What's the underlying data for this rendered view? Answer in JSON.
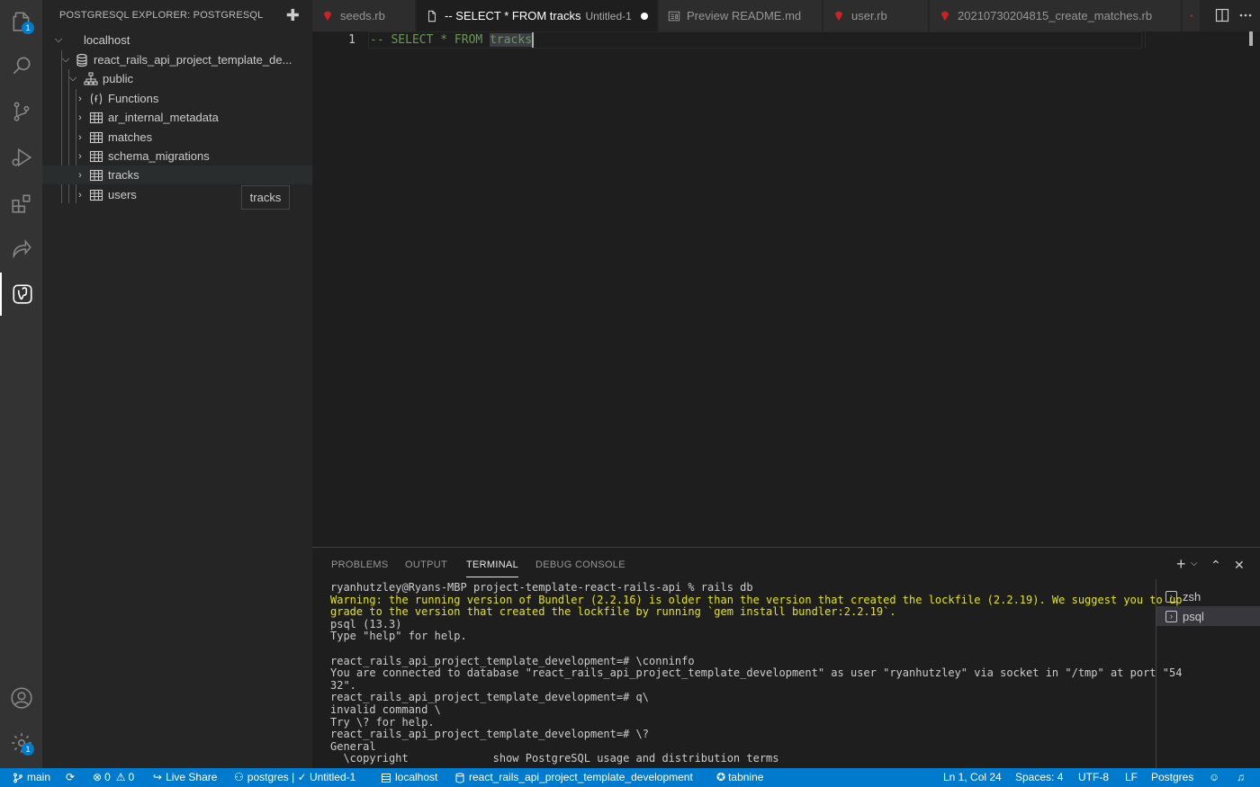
{
  "activity_bar": {
    "explorer_badge": "1",
    "settings_badge": "1"
  },
  "sidebar": {
    "title": "POSTGRESQL EXPLORER: POSTGRESQL",
    "tree": {
      "server": "localhost",
      "database": "react_rails_api_project_template_de...",
      "schema": "public",
      "items": [
        "Functions",
        "ar_internal_metadata",
        "matches",
        "schema_migrations",
        "tracks",
        "users"
      ]
    },
    "tooltip": "tracks"
  },
  "tabs": [
    {
      "label": "seeds.rb"
    },
    {
      "label": "-- SELECT * FROM tracks",
      "sub": "Untitled-1"
    },
    {
      "label": "Preview README.md"
    },
    {
      "label": "user.rb"
    },
    {
      "label": "20210730204815_create_matches.rb"
    }
  ],
  "editor": {
    "line_number": "1",
    "code_prefix": "-- SELECT * FROM ",
    "code_word": "tracks"
  },
  "panel": {
    "tabs": [
      "PROBLEMS",
      "OUTPUT",
      "TERMINAL",
      "DEBUG CONSOLE"
    ],
    "terminal_lines": [
      {
        "text": "ryanhutzley@Ryans-MBP project-template-react-rails-api % rails db",
        "warn": false
      },
      {
        "text": "Warning: the running version of Bundler (2.2.16) is older than the version that created the lockfile (2.2.19). We suggest you to up",
        "warn": true
      },
      {
        "text": "grade to the version that created the lockfile by running `gem install bundler:2.2.19`.",
        "warn": true
      },
      {
        "text": "psql (13.3)",
        "warn": false
      },
      {
        "text": "Type \"help\" for help.",
        "warn": false
      },
      {
        "text": "",
        "warn": false
      },
      {
        "text": "react_rails_api_project_template_development=# \\conninfo",
        "warn": false
      },
      {
        "text": "You are connected to database \"react_rails_api_project_template_development\" as user \"ryanhutzley\" via socket in \"/tmp\" at port \"54",
        "warn": false
      },
      {
        "text": "32\".",
        "warn": false
      },
      {
        "text": "react_rails_api_project_template_development=# q\\",
        "warn": false
      },
      {
        "text": "invalid command \\",
        "warn": false
      },
      {
        "text": "Try \\? for help.",
        "warn": false
      },
      {
        "text": "react_rails_api_project_template_development=# \\?",
        "warn": false
      },
      {
        "text": "General",
        "warn": false
      },
      {
        "text": "  \\copyright             show PostgreSQL usage and distribution terms",
        "warn": false
      }
    ],
    "terminals": [
      "zsh",
      "psql"
    ]
  },
  "status_bar": {
    "branch": "main",
    "errors": "0",
    "warnings": "0",
    "live_share": "Live Share",
    "connection": "postgres | ✓ Untitled-1",
    "server": "localhost",
    "database": "react_rails_api_project_template_development",
    "tabnine": "tabnine",
    "position": "Ln 1, Col 24",
    "spaces": "Spaces: 4",
    "encoding": "UTF-8",
    "eol": "LF",
    "language": "Postgres"
  },
  "colors": {
    "accent": "#007acc",
    "warning_text": "#e5e510",
    "comment": "#6a9955"
  }
}
